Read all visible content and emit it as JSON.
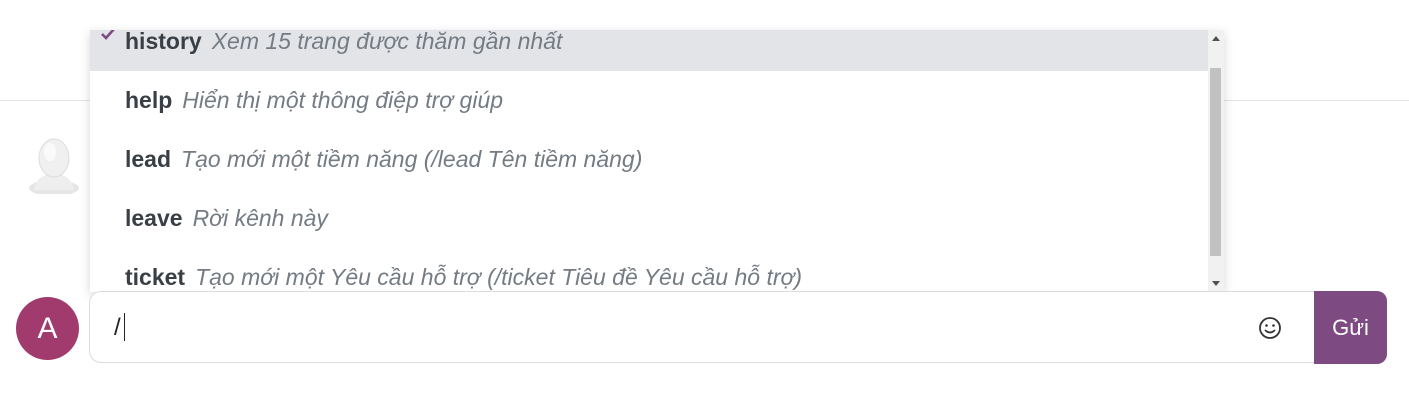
{
  "commands": [
    {
      "name": "history",
      "description": "Xem 15 trang được thăm gần nhất",
      "selected": true
    },
    {
      "name": "help",
      "description": "Hiển thị một thông điệp trợ giúp",
      "selected": false
    },
    {
      "name": "lead",
      "description": "Tạo mới một tiềm năng (/lead Tên tiềm năng)",
      "selected": false
    },
    {
      "name": "leave",
      "description": "Rời kênh này",
      "selected": false
    },
    {
      "name": "ticket",
      "description": "Tạo mới một Yêu cầu hỗ trợ (/ticket Tiêu đề Yêu cầu hỗ trợ)",
      "selected": false
    }
  ],
  "composer": {
    "value": "/",
    "emoji_icon": "smiley-face-icon",
    "send_label": "Gửi"
  },
  "user": {
    "avatar_initial": "A"
  },
  "bot": {
    "avatar_icon": "default-user-silhouette-icon"
  },
  "colors": {
    "accent": "#7d4a82",
    "avatar_bg": "#a23b6d",
    "selected_row": "#e2e4e8",
    "check": "#7d4a82"
  }
}
